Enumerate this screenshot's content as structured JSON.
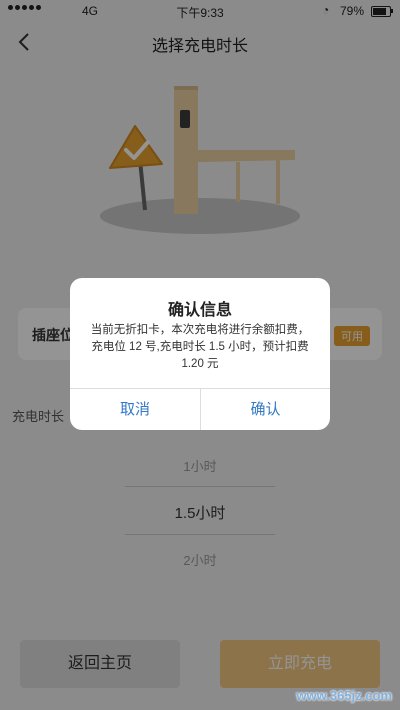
{
  "status_bar": {
    "network": "4G",
    "time": "下午9:33",
    "battery": "79%"
  },
  "nav": {
    "back_icon": "chevron-left-icon",
    "title": "选择充电时长"
  },
  "illustration": {
    "icon": "charging-station-illustration",
    "sign_icon": "checkmark-sign-icon"
  },
  "socket": {
    "label": "插座位",
    "badge": "可用"
  },
  "duration": {
    "label": "充电时长",
    "options": [
      "1小时",
      "1.5小时",
      "2小时"
    ],
    "selected": "1.5小时"
  },
  "buttons": {
    "home": "返回主页",
    "charge": "立即充电"
  },
  "dialog": {
    "title": "确认信息",
    "message": "当前无折扣卡，本次充电将进行余额扣费，充电位 12 号,充电时长 1.5 小时，预计扣费 1.20 元",
    "cancel": "取消",
    "confirm": "确认"
  },
  "watermark": "www.365jz.com",
  "colors": {
    "accent": "#e8a030",
    "dialog_button": "#3478c6",
    "charge_button": "#f3c77e"
  }
}
